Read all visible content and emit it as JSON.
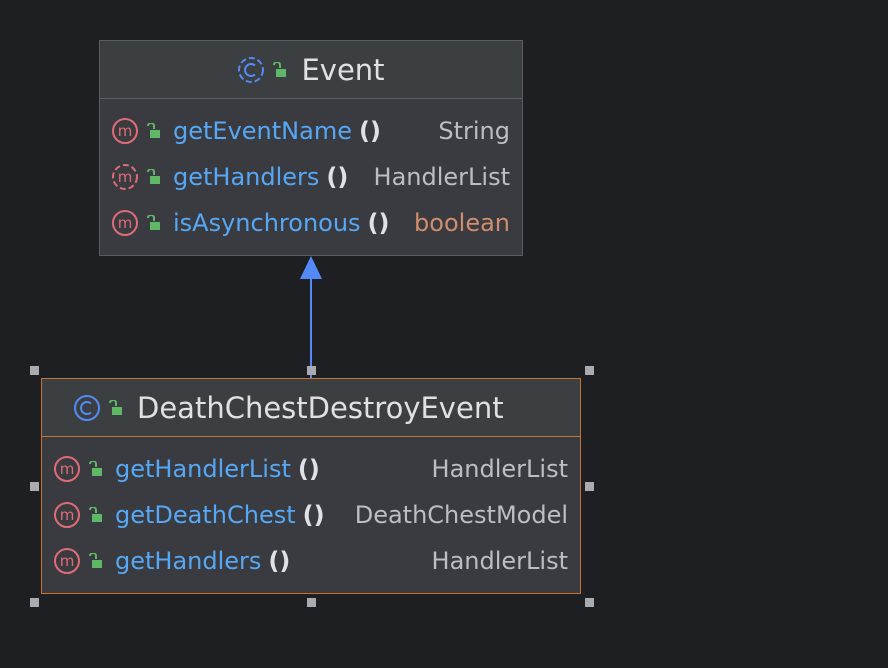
{
  "parent_class": {
    "name": "Event",
    "methods": [
      {
        "name": "getEventName",
        "parens": "()",
        "type": "String"
      },
      {
        "name": "getHandlers",
        "parens": "()",
        "type": "HandlerList"
      },
      {
        "name": "isAsynchronous",
        "parens": "()",
        "type": "boolean"
      }
    ]
  },
  "child_class": {
    "name": "DeathChestDestroyEvent",
    "methods": [
      {
        "name": "getHandlerList",
        "parens": "()",
        "type": "HandlerList"
      },
      {
        "name": "getDeathChest",
        "parens": "()",
        "type": "DeathChestModel"
      },
      {
        "name": "getHandlers",
        "parens": "()",
        "type": "HandlerList"
      }
    ]
  },
  "colors": {
    "background": "#1e1f22",
    "method_name": "#56a8f5",
    "boolean_type": "#cf8e6d",
    "selection_border": "#c8732d",
    "inheritance_arrow": "#548af7"
  }
}
